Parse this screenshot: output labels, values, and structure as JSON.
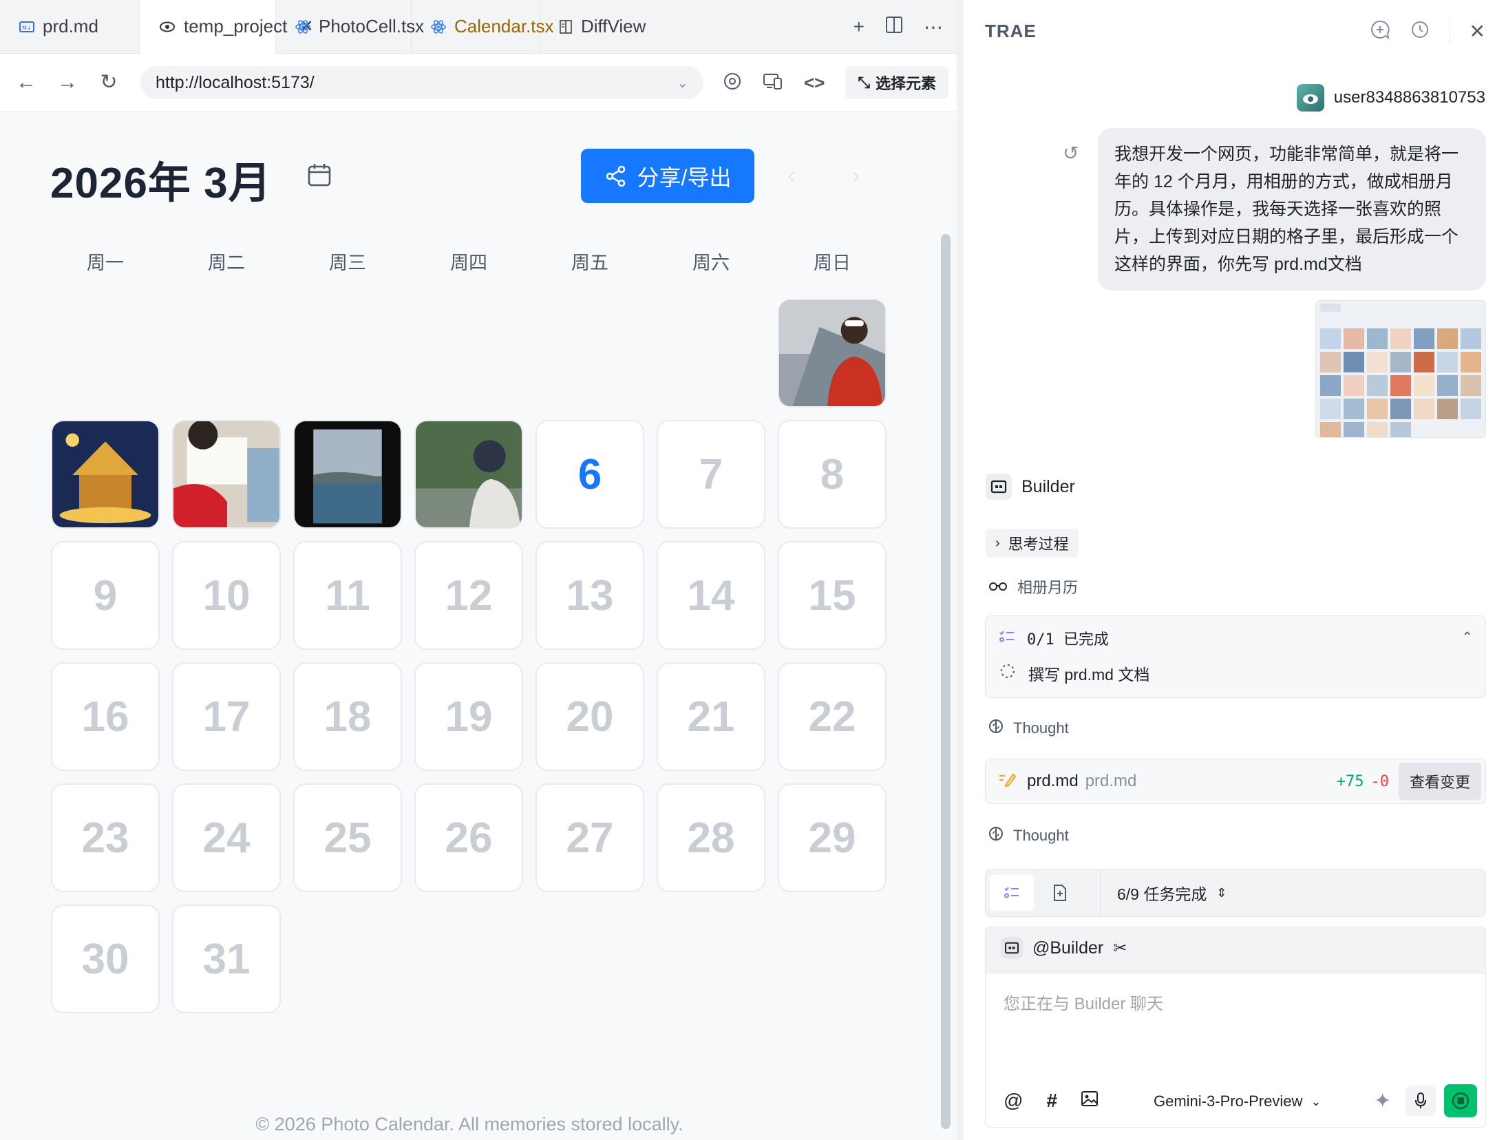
{
  "tabs": [
    {
      "label": "prd.md",
      "icon": "markdown-icon"
    },
    {
      "label": "temp_project",
      "icon": "eye-icon",
      "active": true
    },
    {
      "label": "PhotoCell.tsx",
      "icon": "react-icon"
    },
    {
      "label": "Calendar.tsx",
      "icon": "react-icon",
      "modified": true
    },
    {
      "label": "DiffView",
      "icon": "book-icon"
    }
  ],
  "browser": {
    "url": "http://localhost:5173/",
    "pick_label": "选择元素"
  },
  "calendar": {
    "title": "2026年 3月",
    "share_label": "分享/导出",
    "weekdays": [
      "周一",
      "周二",
      "周三",
      "周四",
      "周五",
      "周六",
      "周日"
    ],
    "days": [
      "6",
      "7",
      "8",
      "9",
      "10",
      "11",
      "12",
      "13",
      "14",
      "15",
      "16",
      "17",
      "18",
      "19",
      "20",
      "21",
      "22",
      "23",
      "24",
      "25",
      "26",
      "27",
      "28",
      "29",
      "30",
      "31"
    ],
    "today": "6",
    "footer": "© 2026 Photo Calendar. All memories stored locally."
  },
  "panel": {
    "title": "TRAE",
    "username": "user8348863810753",
    "message": "我想开发一个网页，功能非常简单，就是将一年的 12 个月月，用相册的方式，做成相册月历。具体操作是，我每天选择一张喜欢的照片，上传到对应日期的格子里，最后形成一个这样的界面，你先写 prd.md文档",
    "agent_name": "Builder",
    "thinking_label": "思考过程",
    "album_label": "相册月历",
    "todo_progress": "0/1 已完成",
    "todo_item": "撰写 prd.md 文档",
    "thought_label": "Thought",
    "file_name": "prd.md",
    "file_path": "prd.md",
    "added": "+75",
    "removed": "-0",
    "view_changes": "查看变更",
    "tasks_progress": "6/9 任务完成",
    "mention": "@Builder",
    "chat_placeholder": "您正在与 Builder 聊天",
    "model": "Gemini-3-Pro-Preview"
  },
  "colors": {
    "accent": "#1677ff",
    "send": "#00c16e"
  }
}
